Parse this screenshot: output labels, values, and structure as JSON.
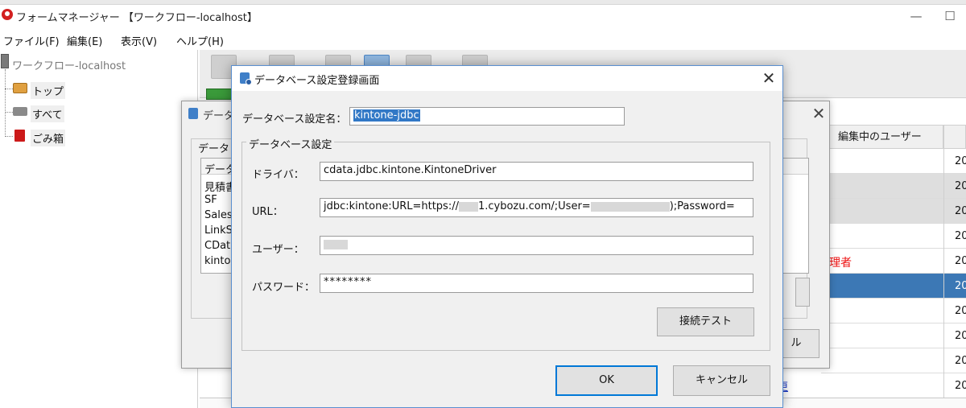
{
  "app": {
    "title": "フォームマネージャー 【ワークフロー-localhost】",
    "menu": [
      "ファイル(F)",
      "編集(E)",
      "表示(V)",
      "ヘルプ(H)"
    ],
    "window_controls": {
      "minimize": "—",
      "maximize": "☐"
    }
  },
  "tree": {
    "root": "ワークフロー-localhost",
    "nodes": [
      "トップ",
      "すべて",
      "ごみ箱"
    ]
  },
  "list": {
    "column_header": "編集中のユーザー",
    "row_prefix": "20",
    "red_cell": "理者",
    "link_text": "更"
  },
  "bg_dialog": {
    "title": "データ",
    "group_label": "データ",
    "list_header": "データ",
    "items": [
      "見積書",
      "SF",
      "Sales",
      "LinkS",
      "CDat",
      "kinto"
    ],
    "partial_button": "ル",
    "close": "✕"
  },
  "dialog": {
    "title": "データベース設定登録画面",
    "close": "✕",
    "name_label": "データベース設定名：",
    "name_value": "kintone-jdbc",
    "group_label": "データベース設定",
    "driver_label": "ドライバ：",
    "driver_value": "cdata.jdbc.kintone.KintoneDriver",
    "url_label": "URL：",
    "url_part1": "jdbc:kintone:URL=https://",
    "url_part2": "1.cybozu.com/;User=",
    "url_part3": ");Password=",
    "user_label": "ユーザー：",
    "password_label": "パスワード：",
    "password_value": "********",
    "test_button": "接続テスト",
    "ok_button": "OK",
    "cancel_button": "キャンセル"
  }
}
